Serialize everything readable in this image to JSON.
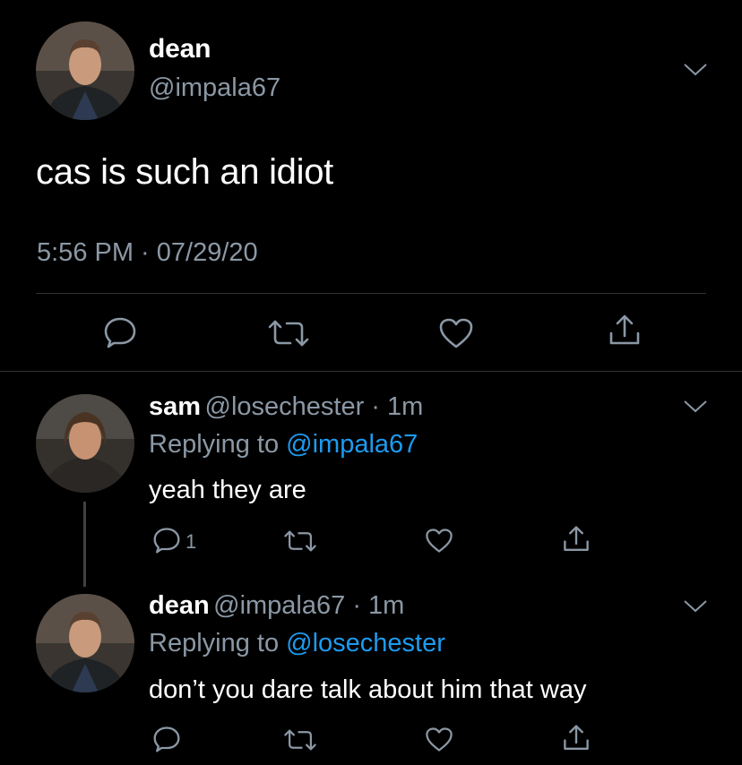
{
  "main_tweet": {
    "display_name": "dean",
    "handle": "@impala67",
    "text": "cas is such an idiot",
    "timestamp": "5:56 PM · 07/29/20"
  },
  "replies": [
    {
      "display_name": "sam",
      "handle": "@losechester",
      "age": "1m",
      "replying_prefix": "Replying to ",
      "replying_to": "@impala67",
      "text": "yeah they are",
      "reply_count": "1"
    },
    {
      "display_name": "dean",
      "handle": "@impala67",
      "age": "1m",
      "replying_prefix": "Replying to ",
      "replying_to": "@losechester",
      "text": "don’t you dare talk about him that way"
    }
  ],
  "icons": {
    "reply": "speech-bubble",
    "retweet": "retweet-arrows",
    "like": "heart",
    "share": "share-upload",
    "more": "chevron-down"
  },
  "colors": {
    "background": "#000000",
    "text": "#ffffff",
    "secondary_text": "#8b98a5",
    "mention": "#1d9bf0",
    "divider": "#2f3336"
  }
}
